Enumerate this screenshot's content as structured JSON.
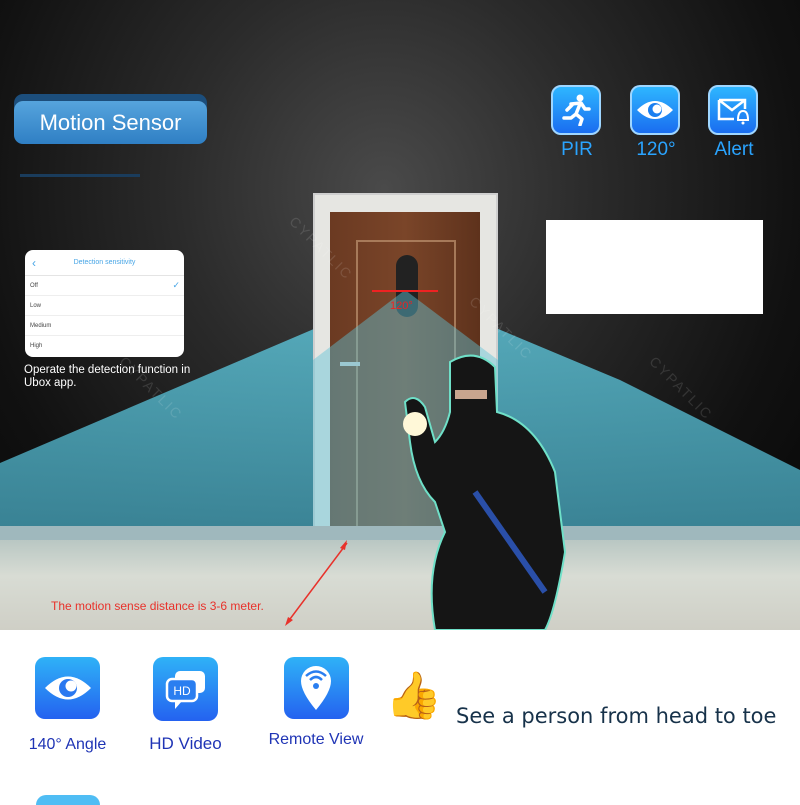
{
  "header": {
    "motion_sensor_label": "Motion Sensor"
  },
  "top_features": [
    {
      "icon": "running-person-icon",
      "label": "PIR"
    },
    {
      "icon": "eye-icon",
      "label": "120°"
    },
    {
      "icon": "mail-bell-icon",
      "label": "Alert"
    }
  ],
  "app_screen": {
    "title": "Detection sensitivity",
    "back_icon": "chevron-left-icon",
    "options": [
      {
        "label": "Off",
        "selected": true
      },
      {
        "label": "Low",
        "selected": false
      },
      {
        "label": "Medium",
        "selected": false
      },
      {
        "label": "High",
        "selected": false
      }
    ],
    "check_glyph": "✓",
    "caption": "Operate the detection function in Ubox app."
  },
  "scene": {
    "angle_label": "120°",
    "distance_note": "The motion sense distance is 3-6 meter.",
    "watermark": "CYPATLIC",
    "colors": {
      "beam": "#4fb7cc",
      "annotation": "#e8322b"
    }
  },
  "bottom_features": [
    {
      "icon": "eye-icon",
      "label": "140° Angle"
    },
    {
      "icon": "hd-chat-icon",
      "label": "HD Video"
    },
    {
      "icon": "location-wifi-icon",
      "label": "Remote View"
    }
  ],
  "tagline": {
    "icon": "thumbs-up-icon",
    "glyph": "👍",
    "text": "See a person from head to toe"
  },
  "colors": {
    "accent_blue": "#2aa4ff",
    "label_navy": "#1f34b5",
    "button_blue": "#3d8fd2"
  }
}
